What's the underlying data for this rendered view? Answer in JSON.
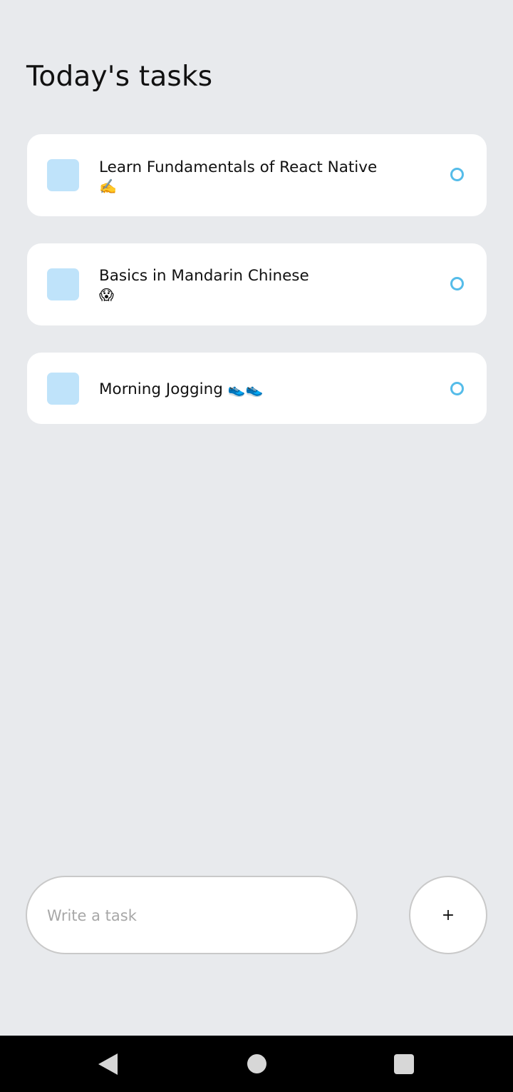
{
  "header": {
    "title": "Today's tasks"
  },
  "tasks": [
    {
      "text": "Learn Fundamentals of React Native",
      "emoji": "✍️"
    },
    {
      "text": "Basics in Mandarin Chinese",
      "emoji": "😱"
    },
    {
      "text": "Morning Jogging",
      "emoji": "👟👟"
    }
  ],
  "input": {
    "placeholder": "Write a task",
    "value": ""
  },
  "add_button": {
    "label": "+"
  },
  "icons": {
    "task_square": "square-icon",
    "task_status": "circle-icon",
    "nav_back": "back-triangle-icon",
    "nav_home": "home-circle-icon",
    "nav_recent": "recent-square-icon"
  },
  "colors": {
    "background": "#e8eaed",
    "card": "#ffffff",
    "square": "#bfe3fa",
    "circle": "#55bce9",
    "navbar": "#000000"
  }
}
